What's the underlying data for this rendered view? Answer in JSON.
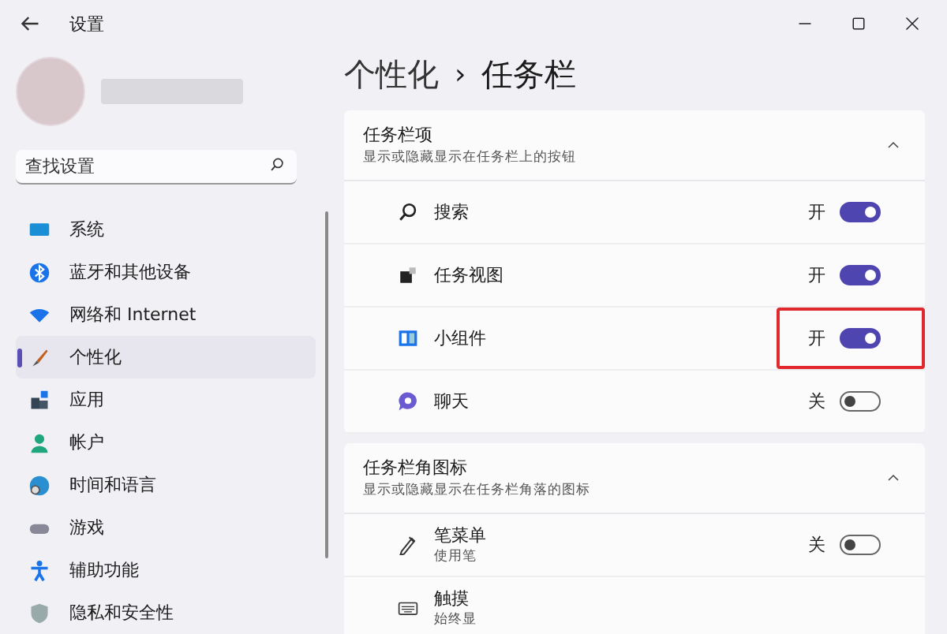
{
  "window": {
    "title": "设置"
  },
  "sidebar": {
    "search": {
      "placeholder": "查找设置"
    },
    "items": [
      {
        "label": "系统",
        "selected": false
      },
      {
        "label": "蓝牙和其他设备",
        "selected": false
      },
      {
        "label": "网络和 Internet",
        "selected": false
      },
      {
        "label": "个性化",
        "selected": true
      },
      {
        "label": "应用",
        "selected": false
      },
      {
        "label": "帐户",
        "selected": false
      },
      {
        "label": "时间和语言",
        "selected": false
      },
      {
        "label": "游戏",
        "selected": false
      },
      {
        "label": "辅助功能",
        "selected": false
      },
      {
        "label": "隐私和安全性",
        "selected": false
      }
    ]
  },
  "breadcrumb": {
    "parent": "个性化",
    "separator": "›",
    "current": "任务栏"
  },
  "sections": [
    {
      "title": "任务栏项",
      "subtitle": "显示或隐藏显示在任务栏上的按钮",
      "expanded": true,
      "rows": [
        {
          "label": "搜索",
          "state_label": "开",
          "on": true,
          "highlighted": false
        },
        {
          "label": "任务视图",
          "state_label": "开",
          "on": true,
          "highlighted": false
        },
        {
          "label": "小组件",
          "state_label": "开",
          "on": true,
          "highlighted": true
        },
        {
          "label": "聊天",
          "state_label": "关",
          "on": false,
          "highlighted": false
        }
      ]
    },
    {
      "title": "任务栏角图标",
      "subtitle": "显示或隐藏显示在任务栏角落的图标",
      "expanded": true,
      "rows": [
        {
          "label": "笔菜单",
          "description": "使用笔",
          "state_label": "关",
          "on": false,
          "highlighted": false
        },
        {
          "label": "触摸",
          "description": "始终显"
        }
      ]
    }
  ]
}
